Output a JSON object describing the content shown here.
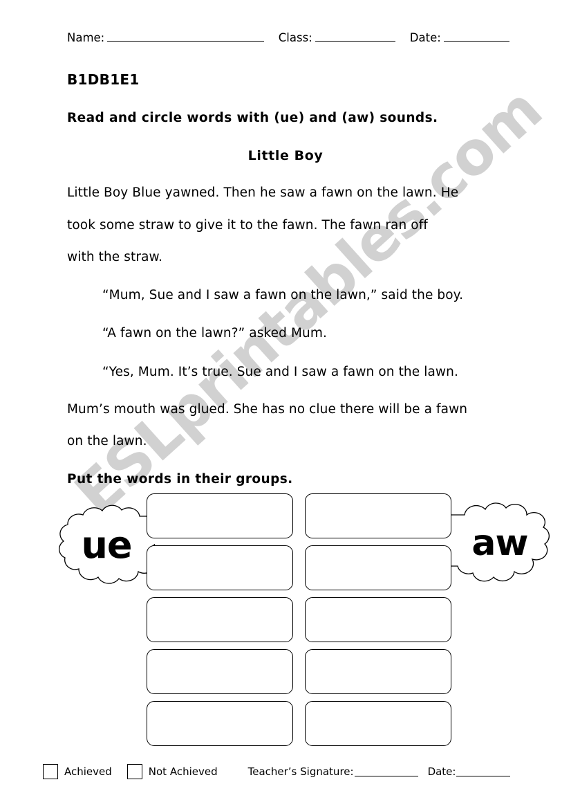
{
  "header": {
    "name_label": "Name:",
    "class_label": "Class:",
    "date_label": "Date:"
  },
  "worksheet": {
    "code": "B1DB1E1",
    "instruction_1": "Read and circle words with (ue) and (aw) sounds.",
    "story_title": "Little Boy",
    "story_lines": [
      "Little Boy Blue yawned. Then he saw a fawn on the lawn. He",
      "took some straw to give it to the fawn. The fawn ran off",
      "with the straw."
    ],
    "quote_lines": [
      "“Mum, Sue and I saw a fawn on the lawn,” said the boy.",
      "“A fawn on the lawn?” asked Mum.",
      "“Yes, Mum. It’s true. Sue and I saw a fawn on the lawn."
    ],
    "closing_lines": [
      "Mum’s mouth was glued. She has no clue there will be a fawn",
      "on the lawn."
    ],
    "instruction_2": "Put the words in their groups."
  },
  "sorting": {
    "left_cloud_label": "ue",
    "right_cloud_label": "aw",
    "rows": 5,
    "columns": 2,
    "box_values": [
      [
        "",
        ""
      ],
      [
        "",
        ""
      ],
      [
        "",
        ""
      ],
      [
        "",
        ""
      ],
      [
        "",
        ""
      ]
    ]
  },
  "footer": {
    "achieved_label": "Achieved",
    "not_achieved_label": "Not Achieved",
    "signature_label": "Teacher’s Signature:",
    "date_label": "Date:"
  },
  "watermark": {
    "text": "ESLprintables.com",
    "color": "#c9c9c9"
  }
}
